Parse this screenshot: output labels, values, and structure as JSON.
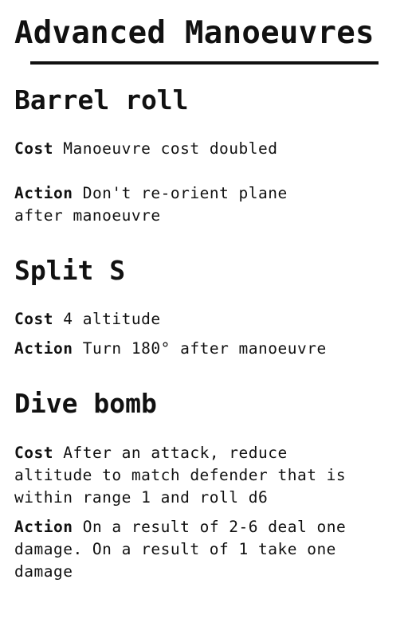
{
  "title": "Advanced Manoeuvres",
  "sections": [
    {
      "heading": "Barrel roll",
      "cost_label": "Cost",
      "cost_text": "Manoeuvre cost doubled",
      "action_label": "Action",
      "action_text": "Don't re-orient plane after manoeuvre"
    },
    {
      "heading": "Split S",
      "cost_label": "Cost",
      "cost_text": "4 altitude",
      "action_label": "Action",
      "action_text": "Turn 180° after manoeuvre"
    },
    {
      "heading": "Dive bomb",
      "cost_label": "Cost",
      "cost_text": "After an attack, reduce altitude to match defender that is within range 1 and roll d6",
      "action_label": "Action",
      "action_text": "On a result of 2-6 deal one damage. On a result of 1 take one damage"
    }
  ]
}
